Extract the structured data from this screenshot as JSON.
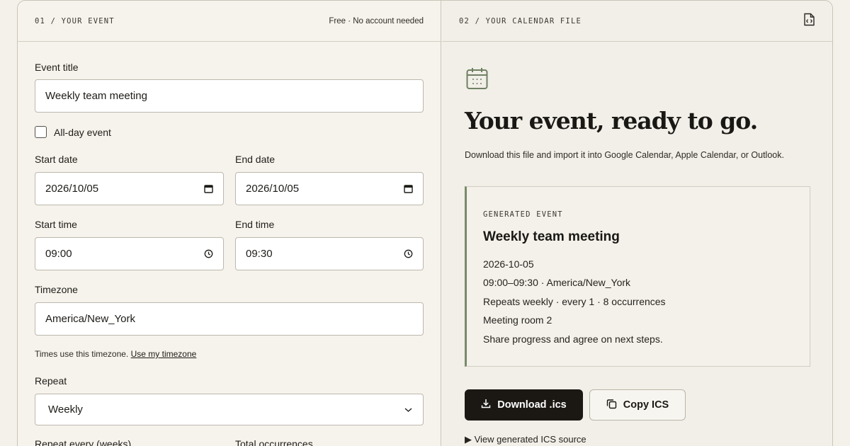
{
  "left": {
    "header_label": "01 / YOUR EVENT",
    "header_note": "Free · No account needed",
    "event_title_label": "Event title",
    "event_title_value": "Weekly team meeting",
    "all_day_label": "All-day event",
    "start_date_label": "Start date",
    "start_date_value": "2026/10/05",
    "end_date_label": "End date",
    "end_date_value": "2026/10/05",
    "start_time_label": "Start time",
    "start_time_value": "09:00",
    "end_time_label": "End time",
    "end_time_value": "09:30",
    "timezone_label": "Timezone",
    "timezone_value": "America/New_York",
    "timezone_hint": "Times use this timezone.",
    "timezone_link": "Use my timezone",
    "repeat_label": "Repeat",
    "repeat_value": "Weekly",
    "repeat_every_label": "Repeat every (weeks)",
    "total_occurrences_label": "Total occurrences"
  },
  "right": {
    "header_label": "02 / YOUR CALENDAR FILE",
    "title": "Your event, ready to go.",
    "subtitle": "Download this file and import it into Google Calendar, Apple Calendar, or Outlook.",
    "card": {
      "label": "GENERATED EVENT",
      "title": "Weekly team meeting",
      "date": "2026-10-05",
      "time": "09:00–09:30 · America/New_York",
      "recurrence": "Repeats weekly · every 1 · 8 occurrences",
      "location": "Meeting room 2",
      "description": "Share progress and agree on next steps."
    },
    "download_label": "Download .ics",
    "copy_label": "Copy ICS",
    "source_toggle": "▶ View generated ICS source"
  },
  "icons": {
    "calendar": "calendar-icon",
    "file_code": "file-code-icon",
    "date_picker": "calendar-small-icon",
    "clock": "clock-icon",
    "chevron": "chevron-down-icon",
    "download": "download-icon",
    "copy": "copy-icon"
  },
  "colors": {
    "accent_green": "#7a8a6a",
    "button_dark": "#1b1814",
    "background": "#f4f1ea"
  }
}
